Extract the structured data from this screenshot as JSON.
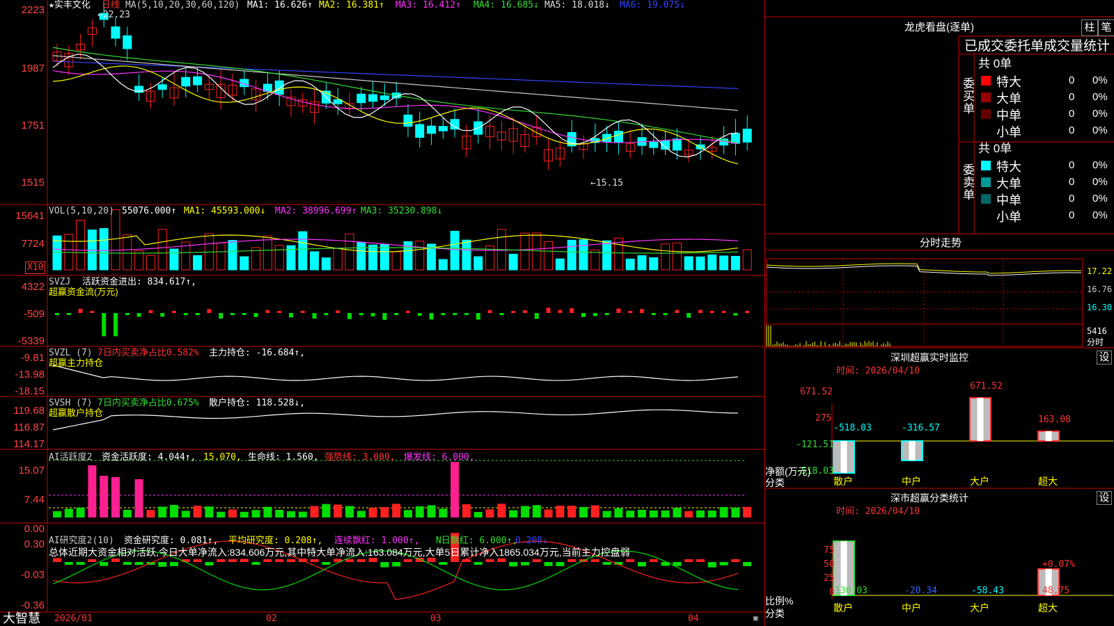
{
  "header": {
    "stock": "★实丰文化",
    "period": "日线",
    "ma_label": "MA(5,10,20,30,60,120)",
    "ma": [
      {
        "t": "MA1: 16.626↑",
        "c": "#ffffff"
      },
      {
        "t": "MA2: 16.381↑",
        "c": "#ffff00"
      },
      {
        "t": "MA3: 16.412↑",
        "c": "#ff33ff"
      },
      {
        "t": "MA4: 16.685↓",
        "c": "#33dd33"
      },
      {
        "t": "MA5: 18.018↓",
        "c": "#dddddd"
      },
      {
        "t": "MA6: 19.075↓",
        "c": "#3344ff"
      }
    ],
    "high_label": "←22.23",
    "low_label": "←15.15"
  },
  "axis": {
    "price": [
      "2223",
      "1987",
      "1751",
      "1515"
    ],
    "vol": [
      "15641",
      "7724"
    ],
    "vol_unit": "X10",
    "svzj": [
      "4322",
      "-509",
      "-5339"
    ],
    "svzl": [
      "-9.81",
      "-13.98",
      "-18.15"
    ],
    "svsh": [
      "119.68",
      "116.87",
      "114.17"
    ],
    "ai1": [
      "15.07",
      "7.44",
      "0.00"
    ],
    "ai2": [
      "0.30",
      "-0.03",
      "-0.36"
    ],
    "dates": [
      "2026/01",
      "02",
      "03",
      "04"
    ]
  },
  "vol_header": {
    "label": "VOL(5,10,20)",
    "v": "55076.000↑",
    "ma1": "MA1: 45593.000↓",
    "ma2": "MA2: 38996.699↑",
    "ma3": "MA3: 35230.898↓"
  },
  "svzj": {
    "label": "SVZJ",
    "v": "活跃资金进出: 834.617↑,",
    "sub": "超赢资金流(万元)"
  },
  "svzl": {
    "label": "SVZL (7)",
    "ratio": "7日内买卖净占比0.582%",
    "v": "主力持仓: -16.684↑,",
    "sub": "超赢主力持仓"
  },
  "svsh": {
    "label": "SVSH (7)",
    "ratio": "7日内买卖净占比0.675%",
    "v": "散户持仓: 118.528↓,",
    "sub": "超赢散户持仓"
  },
  "ai1": {
    "label": "AI活跃度2",
    "a": "资金活跃度: 4.044↑,",
    "b": "15.070,",
    "c": "生命线: 1.560,",
    "d": "强势线: 3.000,",
    "e": "爆发线: 6.000,"
  },
  "ai2": {
    "label": "AI研究度2(10)",
    "a": "资金研究度: 0.081↑,",
    "b": "平均研究度: 0.208↑,",
    "c": "连续飘红: 1.000↑,",
    "d": "N日飘红: 6.000↑,",
    "e": "0.208↓",
    "summary": "总体近期大资金相对活跃,今日大单净流入:834.606万元,其中特大单净流入:163.084万元,大单5日累计净入1865.034万元,当前主力控盘弱"
  },
  "footer": {
    "brand": "大智慧"
  },
  "right": {
    "title": "龙虎看盘(逐单)",
    "btn1": "柱",
    "btn2": "笔",
    "stat_title": "已成交委托单成交量统计",
    "buy": {
      "count": "共 0单",
      "side": "委买单",
      "rows": [
        [
          "特大",
          "0",
          "0%"
        ],
        [
          "大单",
          "0",
          "0%"
        ],
        [
          "中单",
          "0",
          "0%"
        ],
        [
          "小单",
          "0",
          "0%"
        ]
      ]
    },
    "sell": {
      "count": "共 0单",
      "side": "委卖单",
      "rows": [
        [
          "特大",
          "0",
          "0%"
        ],
        [
          "大单",
          "0",
          "0%"
        ],
        [
          "中单",
          "0",
          "0%"
        ],
        [
          "小单",
          "0",
          "0%"
        ]
      ]
    },
    "minute_title": "分时走势",
    "minute_axis": [
      "17.22",
      "16.76",
      "16.30",
      "5416",
      "分时"
    ],
    "sz_title": "深圳超赢实时监控",
    "sz_btn": "设",
    "sz_time": "时间: 2026/04/10",
    "sz_axis": [
      "671.52",
      "275",
      "-121.51",
      "-518.03"
    ],
    "sz_ylabel": "净额(万元)",
    "sz_xlabel": "分类",
    "sz_cats": [
      "散户",
      "中户",
      "大户",
      "超大"
    ],
    "sz_vals": [
      "-518.03",
      "-316.57",
      "671.52",
      "163.08"
    ],
    "ss_title": "深市超赢分类统计",
    "ss_btn": "设",
    "ss_time": "时间: 2026/04/10",
    "ss_axis": [
      "75",
      "50",
      "25",
      "0"
    ],
    "ss_ylabel": "比例%",
    "ss_xlabel": "分类",
    "ss_cats": [
      "散户",
      "中户",
      "大户",
      "超大"
    ],
    "ss_vals": [
      "130.03",
      "-20.34",
      "-58.43",
      "48.75"
    ],
    "ss_note": "+0.07%"
  }
}
